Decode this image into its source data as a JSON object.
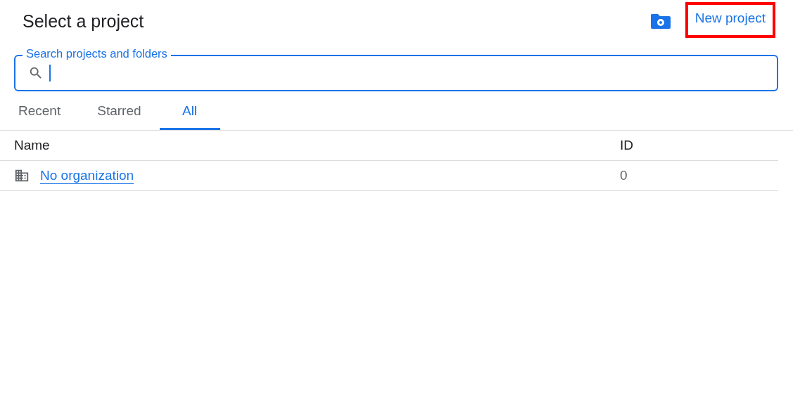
{
  "header": {
    "title": "Select a project",
    "new_project": {
      "label": "New project",
      "highlighted": true
    }
  },
  "search": {
    "label": "Search projects and folders",
    "focused": true
  },
  "tabs": [
    {
      "label": "Recent",
      "selected": false
    },
    {
      "label": "Starred",
      "selected": false
    },
    {
      "label": "All",
      "selected": true
    }
  ],
  "table": {
    "columns": [
      "Name",
      "ID"
    ],
    "rows": [
      {
        "name": "No organization",
        "id": "0"
      }
    ]
  }
}
